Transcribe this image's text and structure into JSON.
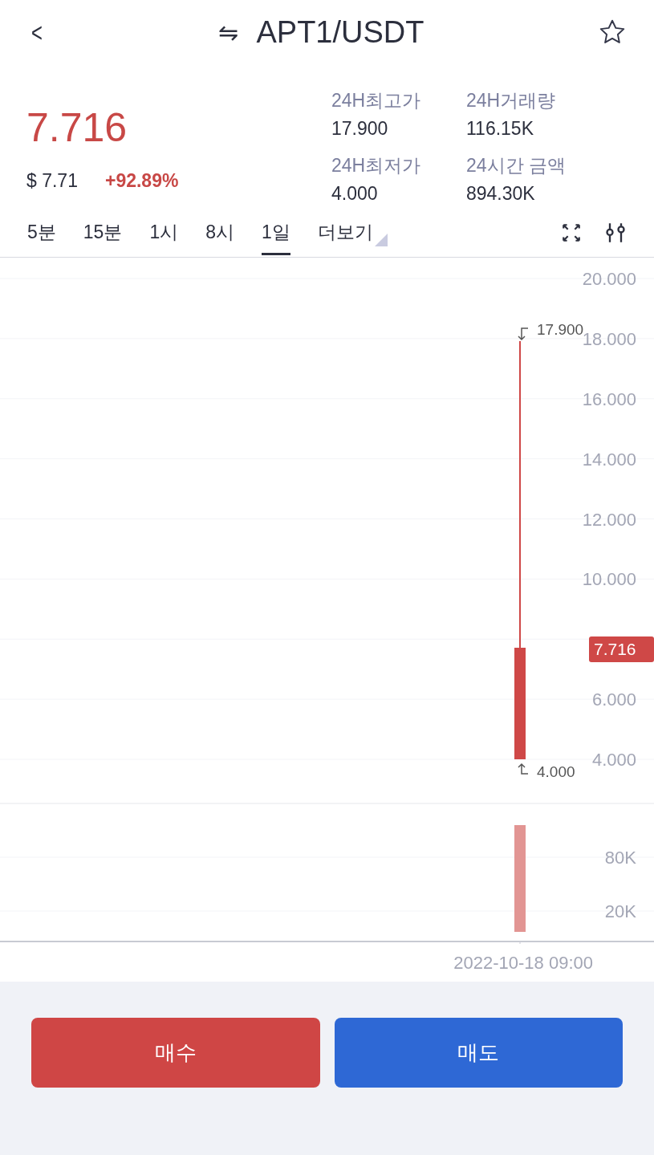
{
  "header": {
    "back": "<",
    "swap": "⇋",
    "pair": "APT1/USDT",
    "favorite": false
  },
  "price": {
    "last": "7.716",
    "usd": "$ 7.71",
    "change": "+92.89%"
  },
  "stats": [
    {
      "label": "24H최고가",
      "value": "17.900"
    },
    {
      "label": "24H거래량",
      "value": "116.15K"
    },
    {
      "label": "24H최저가",
      "value": "4.000"
    },
    {
      "label": "24시간 금액",
      "value": "894.30K"
    }
  ],
  "intervals": [
    {
      "label": "5분",
      "selected": false
    },
    {
      "label": "15분",
      "selected": false
    },
    {
      "label": "1시",
      "selected": false
    },
    {
      "label": "8시",
      "selected": false
    },
    {
      "label": "1일",
      "selected": true
    },
    {
      "label": "더보기",
      "selected": false,
      "kind": "more"
    }
  ],
  "chart": {
    "price_axis": [
      "20.000",
      "18.000",
      "16.000",
      "14.000",
      "12.000",
      "10.000",
      "6.000",
      "4.000"
    ],
    "high_label": "17.900",
    "low_label": "4.000",
    "current_tag": "7.716",
    "volume_axis": [
      "80K",
      "20K"
    ],
    "time_label": "2022-10-18 09:00"
  },
  "actions": [
    {
      "label": "매수",
      "kind": "buy"
    },
    {
      "label": "매도",
      "kind": "sell"
    }
  ]
}
